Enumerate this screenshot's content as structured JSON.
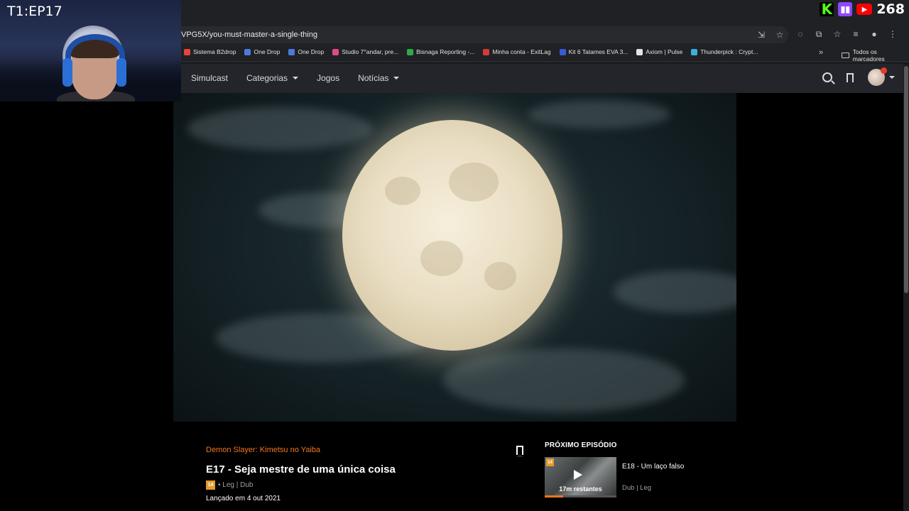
{
  "overlay": {
    "episode_tag": "T1:EP17",
    "viewer_count": "268",
    "platforms": [
      "kick-icon",
      "twitch-icon",
      "youtube-icon"
    ]
  },
  "browser": {
    "url": "VPG5X/you-must-master-a-single-thing",
    "bookmarks": [
      {
        "label": "Sistema B2drop",
        "color": "#e8453c"
      },
      {
        "label": "One Drop",
        "color": "#4a7bdc"
      },
      {
        "label": "One Drop",
        "color": "#4a7bdc"
      },
      {
        "label": "Studio 7°andar, pre...",
        "color": "#e0488a"
      },
      {
        "label": "Bisnaga Reporting -...",
        "color": "#2eaa4a"
      },
      {
        "label": "Minha conta - ExitLag",
        "color": "#d83a3a"
      },
      {
        "label": "Kit 6 Tatames EVA 3...",
        "color": "#3a5ad8"
      },
      {
        "label": "Axiom | Pulse",
        "color": "#e3e3e3"
      },
      {
        "label": "Thunderpick : Crypt...",
        "color": "#3ab0e0"
      }
    ],
    "bookmarks_folder": "Todos os marcadores"
  },
  "site": {
    "nav": [
      {
        "label": "Simulcast",
        "dropdown": false
      },
      {
        "label": "Categorias",
        "dropdown": true
      },
      {
        "label": "Jogos",
        "dropdown": false
      },
      {
        "label": "Notícias",
        "dropdown": true
      }
    ]
  },
  "episode": {
    "series": "Demon Slayer: Kimetsu no Yaiba",
    "title": "E17 - Seja mestre de uma única coisa",
    "rating": "14",
    "audio": "• Leg | Dub",
    "release": "Lançado em 4 out 2021"
  },
  "next": {
    "label": "PRÓXIMO EPISÓDIO",
    "rating": "14",
    "title": "E18 - Um laço falso",
    "remaining": "17m restantes",
    "meta": "Dub | Leg",
    "progress": 0.26
  },
  "colors": {
    "accent": "#f47521",
    "rating": "#e39b2d"
  }
}
